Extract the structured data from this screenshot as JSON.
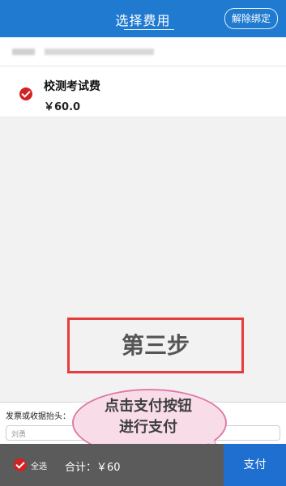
{
  "header": {
    "title": "选择费用",
    "unbind_label": "解除绑定"
  },
  "fee_item": {
    "name": "校测考试费",
    "price": "￥60.0"
  },
  "annotation": {
    "step_label": "第三步",
    "bubble_line1": "点击支付按钮",
    "bubble_line2": "进行支付"
  },
  "invoice": {
    "label": "发票或收据抬头：",
    "value": "刘勇"
  },
  "footer": {
    "select_all": "全选",
    "total": "合计：￥60",
    "pay_label": "支付"
  }
}
